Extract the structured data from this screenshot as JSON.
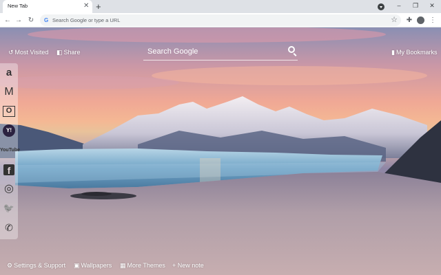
{
  "browser": {
    "tab_title": "New Tab",
    "tab_close": "✕",
    "new_tab": "+",
    "win_min": "–",
    "win_max": "❐",
    "win_close": "✕",
    "omnibox_placeholder": "Search Google or type a URL",
    "google_g": "G",
    "back": "←",
    "forward": "→",
    "reload": "↻",
    "star": "☆",
    "extensions": "✚",
    "menu": "⋮"
  },
  "newtab": {
    "most_visited_label": "Most Visited",
    "share_label": "Share",
    "search_placeholder": "Search Google",
    "bookmarks_label": "My Bookmarks"
  },
  "sidebar": {
    "items": [
      {
        "name": "amazon",
        "glyph": "a"
      },
      {
        "name": "gmail",
        "glyph": "M"
      },
      {
        "name": "outlook",
        "glyph": "O"
      },
      {
        "name": "yahoo",
        "glyph": "Y!"
      },
      {
        "name": "youtube",
        "glyph": "YouTube"
      },
      {
        "name": "facebook",
        "glyph": "f"
      },
      {
        "name": "instagram",
        "glyph": "◎"
      },
      {
        "name": "twitter",
        "glyph": "🐦"
      },
      {
        "name": "whatsapp",
        "glyph": "✆"
      }
    ]
  },
  "footer": {
    "settings_label": "Settings & Support",
    "wallpapers_label": "Wallpapers",
    "themes_label": "More Themes",
    "new_note_label": "+ New note"
  }
}
